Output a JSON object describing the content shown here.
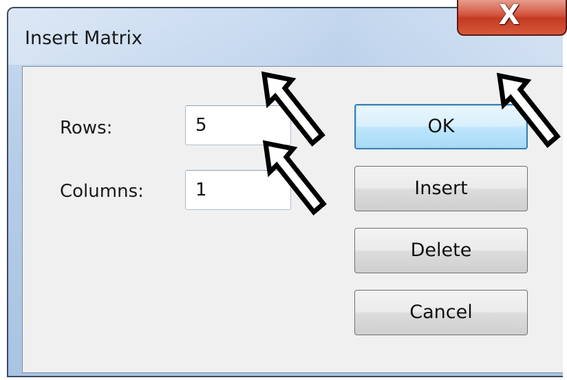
{
  "window": {
    "title": "Insert Matrix",
    "close_label": "X"
  },
  "form": {
    "rows_label": "Rows:",
    "rows_value": "5",
    "columns_label": "Columns:",
    "columns_value": "1"
  },
  "buttons": {
    "ok": "OK",
    "insert": "Insert",
    "delete": "Delete",
    "cancel": "Cancel"
  },
  "colors": {
    "titlebar": "#b6cde8",
    "close_button": "#c33a22",
    "default_button_border": "#3c7fb1",
    "client_background": "#f0f0f0"
  },
  "icons": {
    "close": "close-icon",
    "arrow": "pointer-arrow-icon"
  }
}
